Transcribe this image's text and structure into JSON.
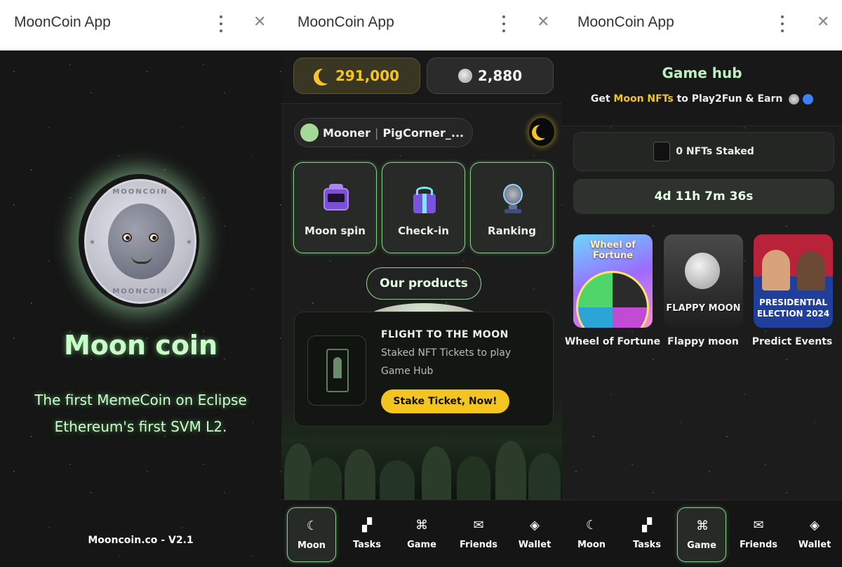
{
  "app": {
    "window_title": "MoonCoin App"
  },
  "splash": {
    "coin_text_top": "MOONCOIN",
    "coin_text_bottom": "MOONCOIN",
    "title": "Moon coin",
    "tagline_1": "The first MemeCoin on Eclipse",
    "tagline_2": "Ethereum's first SVM L2.",
    "footer": "Mooncoin.co - V2.1"
  },
  "home": {
    "moon_balance": "291,000",
    "silver_balance": "2,880",
    "user_level": "Mooner",
    "user_name": "PigCorner_...",
    "features": [
      {
        "label": "Moon spin",
        "icon": "slot-machine-icon"
      },
      {
        "label": "Check-in",
        "icon": "gift-box-icon"
      },
      {
        "label": "Ranking",
        "icon": "trophy-icon"
      }
    ],
    "products_button": "Our products",
    "flight_card": {
      "title": "FLIGHT TO THE MOON",
      "desc_1": "Staked NFT Tickets to play",
      "desc_2": "Game Hub",
      "button": "Stake Ticket, Now!"
    }
  },
  "gamehub": {
    "title": "Game hub",
    "sub_pre": "Get ",
    "sub_highlight": "Moon NFTs",
    "sub_post": " to Play2Fun & Earn",
    "staked": "0 NFTs Staked",
    "timer": "4d 11h 7m 36s",
    "games": [
      {
        "name": "Wheel of Fortune",
        "art_title": "Wheel of Fortune"
      },
      {
        "name": "Flappy moon",
        "art_title": "FLAPPY MOON"
      },
      {
        "name": "Predict Events",
        "art_title_1": "PRESIDENTIAL",
        "art_title_2": "ELECTION 2024"
      }
    ]
  },
  "nav": [
    {
      "label": "Moon",
      "icon": "moon-icon"
    },
    {
      "label": "Tasks",
      "icon": "clapper-icon"
    },
    {
      "label": "Game",
      "icon": "gamepad-icon"
    },
    {
      "label": "Friends",
      "icon": "mail-icon"
    },
    {
      "label": "Wallet",
      "icon": "wallet-icon"
    }
  ],
  "colors": {
    "accent": "#8ad08a",
    "gold": "#f4c520",
    "bg": "#1b1c1b",
    "glow_text": "#c9ffc9"
  }
}
